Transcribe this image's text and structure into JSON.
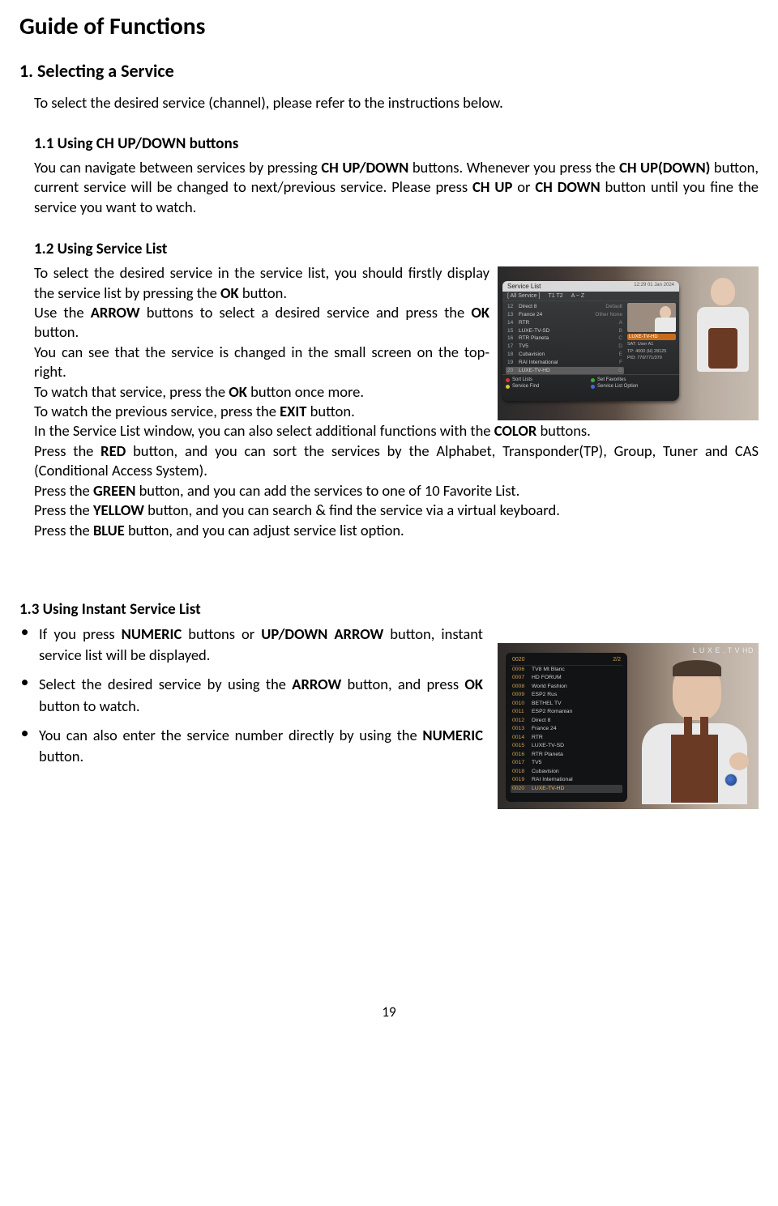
{
  "title": "Guide of Functions",
  "section1": {
    "heading": "1. Selecting a Service",
    "intro": "To select the desired service (channel), please refer to the instructions below."
  },
  "s11": {
    "heading": "1.1  Using CH UP/DOWN buttons",
    "t1": "You can navigate between services by pressing ",
    "b1": "CH UP/DOWN",
    "t2": " buttons. Whenever you press the ",
    "b2": "CH UP(DOWN)",
    "t3": " button, current service will be changed to next/previous service. Please press ",
    "b3": "CH UP",
    "t4": " or ",
    "b4": "CH DOWN",
    "t5": " button until you fine the service you want to watch."
  },
  "s12": {
    "heading": "1.2  Using Service List",
    "p1a": "To select the desired service in the service list, you should firstly display the service list by pressing the ",
    "p1b": "OK",
    "p1c": " button.",
    "p2a": "Use the ",
    "p2b": "ARROW",
    "p2c": " buttons to select a desired service and press the ",
    "p2d": "OK",
    "p2e": " button.",
    "p3": "You can see that the service is changed in the small screen on the top-right.",
    "p4a": "To watch that service, press the ",
    "p4b": "OK",
    "p4c": " button once more.",
    "p5a": "To watch the previous service, press the ",
    "p5b": "EXIT",
    "p5c": " button.",
    "p6a": "In the Service List window, you can also select additional functions with the ",
    "p6b": "COLOR",
    "p6c": " buttons.",
    "p7a": "Press the ",
    "p7b": "RED",
    "p7c": " button, and you can sort the services by the Alphabet, Transponder(TP), Group, Tuner and CAS (Conditional Access System).",
    "p8a": "Press the ",
    "p8b": "GREEN",
    "p8c": " button, and you can add the services to one of 10 Favorite List.",
    "p9a": "Press the ",
    "p9b": "YELLOW",
    "p9c": " button, and you can search & find the service via a virtual keyboard.",
    "p10a": "Press the ",
    "p10b": "BLUE",
    "p10c": " button, and you can adjust service list option."
  },
  "s13": {
    "heading": "1.3  Using Instant Service List",
    "b1a": "If you press ",
    "b1b": "NUMERIC",
    "b1c": " buttons or ",
    "b1d": "UP/DOWN ARROW",
    "b1e": " button, instant service list will be displayed.",
    "b2a": "Select the desired service by using the ",
    "b2b": "ARROW",
    "b2c": " button, and press ",
    "b2d": "OK",
    "b2e": " button to watch.",
    "b3a": "You can also enter the service number directly by using the ",
    "b3b": "NUMERIC",
    "b3c": " button."
  },
  "osd": {
    "title": "Service List",
    "date": "12:29 01 Jan 2024",
    "tab_all": "[ All Service ]",
    "tab_t": "T1  T2",
    "tab_sort": "A ~ Z",
    "rows": [
      {
        "n": "12",
        "name": "Direct 8",
        "k": "Default"
      },
      {
        "n": "13",
        "name": "France 24",
        "k": "Other None"
      },
      {
        "n": "14",
        "name": "RTR",
        "k": "A"
      },
      {
        "n": "15",
        "name": "LUXE-TV-SD",
        "k": "B"
      },
      {
        "n": "16",
        "name": "RTR Planeta",
        "k": "C"
      },
      {
        "n": "17",
        "name": "TV5",
        "k": "D"
      },
      {
        "n": "18",
        "name": "Cubavision",
        "k": "E"
      },
      {
        "n": "19",
        "name": "RAI International",
        "k": "F"
      },
      {
        "n": "20",
        "name": "LUXE-TV-HD",
        "k": "G"
      }
    ],
    "hl_index": 8,
    "pip_label": "LUXE-TV-HD",
    "pip_meta1": "SAT: User A1",
    "pip_meta2": "TP: 4000 (H) 28125",
    "pip_meta3": "PID: 770/771/370",
    "foot": {
      "sort": "Sort Lists",
      "fav": "Set Favorites",
      "find": "Service Find",
      "opt": "Service List Option"
    }
  },
  "instant": {
    "head_left": "0020",
    "head_right": "2/2",
    "brand": "L U X E . T V  HD",
    "rows": [
      {
        "n": "0006",
        "name": "TV8 Mt Blanc"
      },
      {
        "n": "0007",
        "name": "HD FORUM"
      },
      {
        "n": "0008",
        "name": "World Fashion"
      },
      {
        "n": "0009",
        "name": "ESP2 Rus"
      },
      {
        "n": "0010",
        "name": "BETHEL TV"
      },
      {
        "n": "0011",
        "name": "ESP2 Romanian"
      },
      {
        "n": "0012",
        "name": "Direct 8"
      },
      {
        "n": "0013",
        "name": "France 24"
      },
      {
        "n": "0014",
        "name": "RTR"
      },
      {
        "n": "0015",
        "name": "LUXE-TV-SD"
      },
      {
        "n": "0016",
        "name": "RTR Planeta"
      },
      {
        "n": "0017",
        "name": "TV5"
      },
      {
        "n": "0018",
        "name": "Cubavision"
      },
      {
        "n": "0019",
        "name": "RAI International"
      },
      {
        "n": "0020",
        "name": "LUXE-TV-HD"
      }
    ],
    "hl_index": 14
  },
  "pagenum": "19"
}
